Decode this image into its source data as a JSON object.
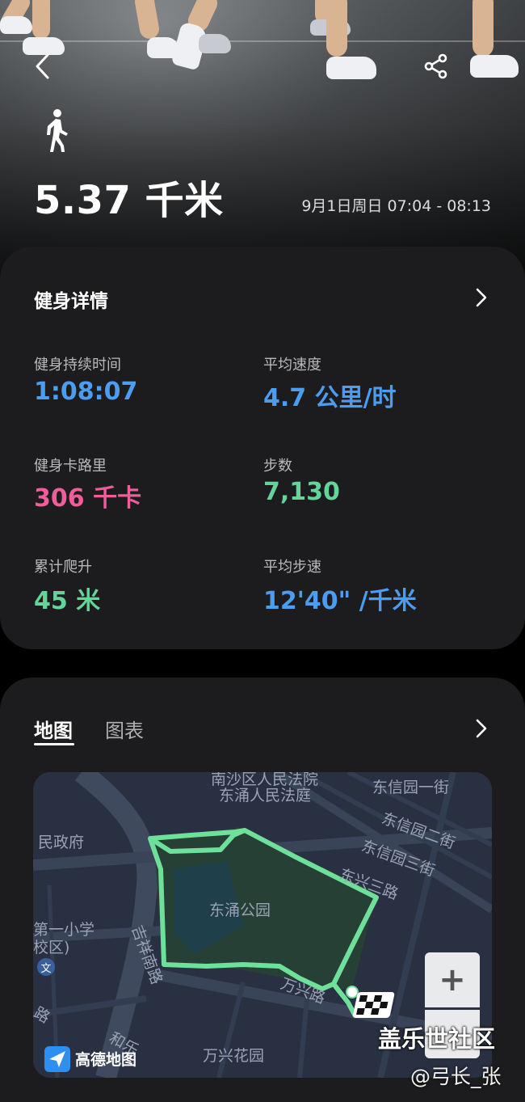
{
  "header": {
    "distance": "5.37 千米",
    "date_range": "9月1日周日 07:04 - 08:13",
    "back_icon": "chevron-left-icon",
    "share_icon": "share-icon",
    "activity_icon": "walking-person-icon"
  },
  "details": {
    "title": "健身详情",
    "stats": [
      {
        "label": "健身持续时间",
        "value": "1:08:07",
        "color": "#4c9cf0"
      },
      {
        "label": "平均速度",
        "value": "4.7 公里/时",
        "color": "#4c9cf0"
      },
      {
        "label": "健身卡路里",
        "value": "306 千卡",
        "color": "#ef5d9b"
      },
      {
        "label": "步数",
        "value": "7,130",
        "color": "#63d49a"
      },
      {
        "label": "累计爬升",
        "value": "45 米",
        "color": "#63d49a"
      },
      {
        "label": "平均步速",
        "value": "12'40\" /千米",
        "color": "#4c9cf0"
      }
    ]
  },
  "map_section": {
    "tabs": [
      {
        "label": "地图",
        "active": true
      },
      {
        "label": "图表",
        "active": false
      }
    ],
    "map_labels": {
      "court1": "南沙区人民法院",
      "court2": "东涌人民法庭",
      "gov": "民政府",
      "school1": "第一小学",
      "school2": "校区)",
      "park": "东涌公园",
      "road_jixiang": "吉祥南路",
      "road_wanxing": "万兴路",
      "garden": "万兴花园",
      "road_he": "和乐",
      "xinyuan2": "东信园二街",
      "xinyuan3": "东信园三街",
      "xingsan": "东兴三路",
      "road_top": "路",
      "road_left": "路",
      "xinyuan_top": "东信园一街",
      "wen": "文"
    },
    "zoom_in": "+",
    "provider": "高德地图"
  },
  "watermark": {
    "community": "盖乐世社区",
    "author": "@弓长_张"
  },
  "colors": {
    "accent_blue": "#4c9cf0",
    "accent_pink": "#ef5d9b",
    "accent_green": "#63d49a",
    "route": "#6ee09a",
    "card": "#1c1c1e"
  }
}
